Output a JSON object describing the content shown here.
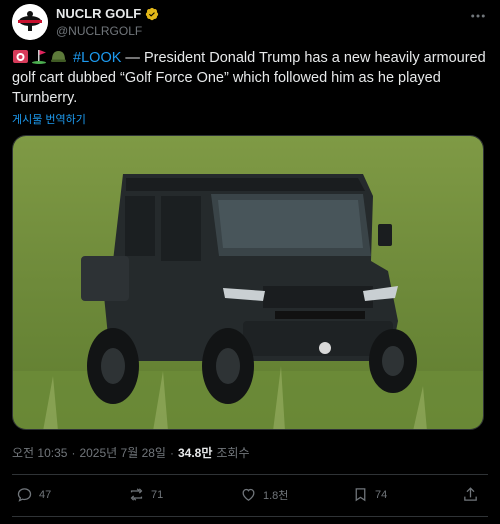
{
  "account": {
    "display_name": "NUCLR GOLF",
    "handle": "@NUCLRGOLF",
    "avatar_icon": "nuclr-golf-logo",
    "verified_icon": "verified-badge-icon",
    "more_icon": "more-options-icon"
  },
  "tweet": {
    "emojis": [
      "siren-emoji",
      "golf-flag-emoji",
      "military-helmet-emoji"
    ],
    "hashtag": "#LOOK",
    "body": " — President Donald Trump has a new heavily armoured golf cart dubbed “Golf Force One” which followed him as he played Turnberry.",
    "translate_label": "게시물 번역하기"
  },
  "media": {
    "icon": "armoured-golf-cart-photo"
  },
  "meta": {
    "time": "오전 10:35",
    "separator": "·",
    "date": "2025년 7월 28일",
    "views_count": "34.8만",
    "views_label": "조회수"
  },
  "actions": {
    "reply_count": "47",
    "repost_count": "71",
    "like_count": "1.8천",
    "bookmark_count": "74"
  },
  "colors": {
    "background": "#000000",
    "text": "#e7e9ea",
    "muted": "#71767b",
    "accent": "#1d9bf0",
    "verified": "#e2b719"
  }
}
